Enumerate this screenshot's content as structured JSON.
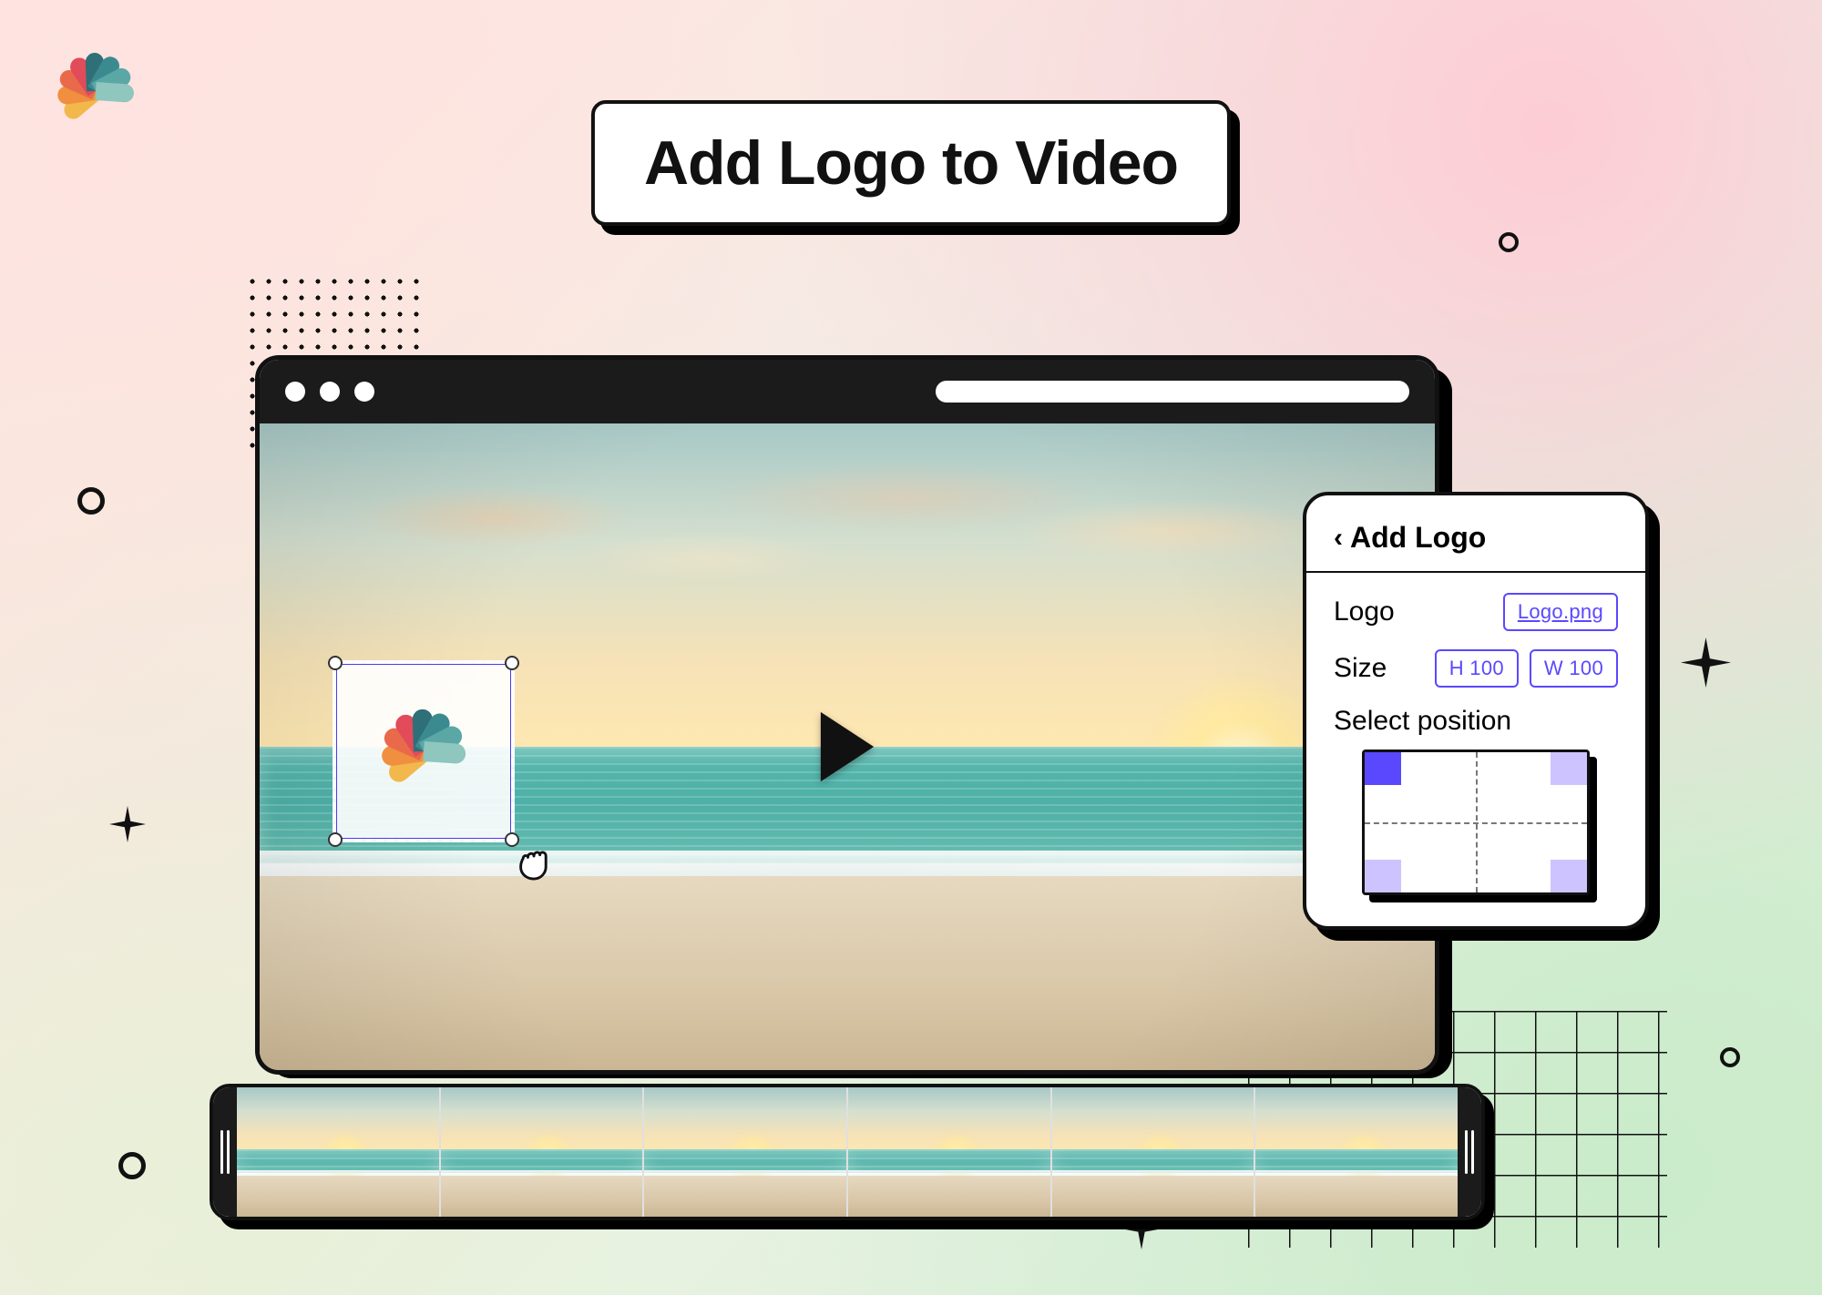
{
  "title": "Add Logo to Video",
  "panel": {
    "heading": "Add Logo",
    "logo_label": "Logo",
    "logo_file": "Logo.png",
    "size_label": "Size",
    "height_chip": "H 100",
    "width_chip": "W 100",
    "position_label": "Select position",
    "selected_corner": "top-left"
  },
  "logo_colors": [
    "#f2b84b",
    "#ef8f3f",
    "#e96a4a",
    "#e14b5a",
    "#2f6f77",
    "#3b8a8f",
    "#5aa7a6",
    "#8fc6be"
  ],
  "timeline_frame_count": 6
}
